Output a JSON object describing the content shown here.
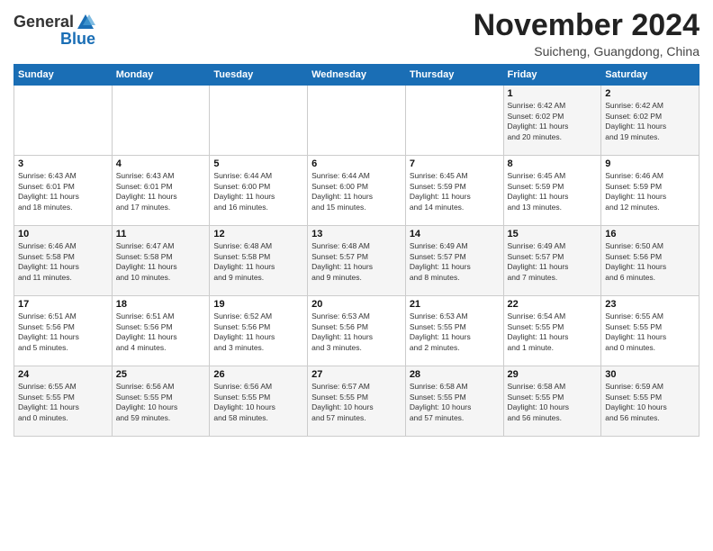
{
  "header": {
    "logo_general": "General",
    "logo_blue": "Blue",
    "month_title": "November 2024",
    "subtitle": "Suicheng, Guangdong, China"
  },
  "days_of_week": [
    "Sunday",
    "Monday",
    "Tuesday",
    "Wednesday",
    "Thursday",
    "Friday",
    "Saturday"
  ],
  "weeks": [
    [
      {
        "day": "",
        "info": ""
      },
      {
        "day": "",
        "info": ""
      },
      {
        "day": "",
        "info": ""
      },
      {
        "day": "",
        "info": ""
      },
      {
        "day": "",
        "info": ""
      },
      {
        "day": "1",
        "info": "Sunrise: 6:42 AM\nSunset: 6:02 PM\nDaylight: 11 hours\nand 20 minutes."
      },
      {
        "day": "2",
        "info": "Sunrise: 6:42 AM\nSunset: 6:02 PM\nDaylight: 11 hours\nand 19 minutes."
      }
    ],
    [
      {
        "day": "3",
        "info": "Sunrise: 6:43 AM\nSunset: 6:01 PM\nDaylight: 11 hours\nand 18 minutes."
      },
      {
        "day": "4",
        "info": "Sunrise: 6:43 AM\nSunset: 6:01 PM\nDaylight: 11 hours\nand 17 minutes."
      },
      {
        "day": "5",
        "info": "Sunrise: 6:44 AM\nSunset: 6:00 PM\nDaylight: 11 hours\nand 16 minutes."
      },
      {
        "day": "6",
        "info": "Sunrise: 6:44 AM\nSunset: 6:00 PM\nDaylight: 11 hours\nand 15 minutes."
      },
      {
        "day": "7",
        "info": "Sunrise: 6:45 AM\nSunset: 5:59 PM\nDaylight: 11 hours\nand 14 minutes."
      },
      {
        "day": "8",
        "info": "Sunrise: 6:45 AM\nSunset: 5:59 PM\nDaylight: 11 hours\nand 13 minutes."
      },
      {
        "day": "9",
        "info": "Sunrise: 6:46 AM\nSunset: 5:59 PM\nDaylight: 11 hours\nand 12 minutes."
      }
    ],
    [
      {
        "day": "10",
        "info": "Sunrise: 6:46 AM\nSunset: 5:58 PM\nDaylight: 11 hours\nand 11 minutes."
      },
      {
        "day": "11",
        "info": "Sunrise: 6:47 AM\nSunset: 5:58 PM\nDaylight: 11 hours\nand 10 minutes."
      },
      {
        "day": "12",
        "info": "Sunrise: 6:48 AM\nSunset: 5:58 PM\nDaylight: 11 hours\nand 9 minutes."
      },
      {
        "day": "13",
        "info": "Sunrise: 6:48 AM\nSunset: 5:57 PM\nDaylight: 11 hours\nand 9 minutes."
      },
      {
        "day": "14",
        "info": "Sunrise: 6:49 AM\nSunset: 5:57 PM\nDaylight: 11 hours\nand 8 minutes."
      },
      {
        "day": "15",
        "info": "Sunrise: 6:49 AM\nSunset: 5:57 PM\nDaylight: 11 hours\nand 7 minutes."
      },
      {
        "day": "16",
        "info": "Sunrise: 6:50 AM\nSunset: 5:56 PM\nDaylight: 11 hours\nand 6 minutes."
      }
    ],
    [
      {
        "day": "17",
        "info": "Sunrise: 6:51 AM\nSunset: 5:56 PM\nDaylight: 11 hours\nand 5 minutes."
      },
      {
        "day": "18",
        "info": "Sunrise: 6:51 AM\nSunset: 5:56 PM\nDaylight: 11 hours\nand 4 minutes."
      },
      {
        "day": "19",
        "info": "Sunrise: 6:52 AM\nSunset: 5:56 PM\nDaylight: 11 hours\nand 3 minutes."
      },
      {
        "day": "20",
        "info": "Sunrise: 6:53 AM\nSunset: 5:56 PM\nDaylight: 11 hours\nand 3 minutes."
      },
      {
        "day": "21",
        "info": "Sunrise: 6:53 AM\nSunset: 5:55 PM\nDaylight: 11 hours\nand 2 minutes."
      },
      {
        "day": "22",
        "info": "Sunrise: 6:54 AM\nSunset: 5:55 PM\nDaylight: 11 hours\nand 1 minute."
      },
      {
        "day": "23",
        "info": "Sunrise: 6:55 AM\nSunset: 5:55 PM\nDaylight: 11 hours\nand 0 minutes."
      }
    ],
    [
      {
        "day": "24",
        "info": "Sunrise: 6:55 AM\nSunset: 5:55 PM\nDaylight: 11 hours\nand 0 minutes."
      },
      {
        "day": "25",
        "info": "Sunrise: 6:56 AM\nSunset: 5:55 PM\nDaylight: 10 hours\nand 59 minutes."
      },
      {
        "day": "26",
        "info": "Sunrise: 6:56 AM\nSunset: 5:55 PM\nDaylight: 10 hours\nand 58 minutes."
      },
      {
        "day": "27",
        "info": "Sunrise: 6:57 AM\nSunset: 5:55 PM\nDaylight: 10 hours\nand 57 minutes."
      },
      {
        "day": "28",
        "info": "Sunrise: 6:58 AM\nSunset: 5:55 PM\nDaylight: 10 hours\nand 57 minutes."
      },
      {
        "day": "29",
        "info": "Sunrise: 6:58 AM\nSunset: 5:55 PM\nDaylight: 10 hours\nand 56 minutes."
      },
      {
        "day": "30",
        "info": "Sunrise: 6:59 AM\nSunset: 5:55 PM\nDaylight: 10 hours\nand 56 minutes."
      }
    ]
  ]
}
